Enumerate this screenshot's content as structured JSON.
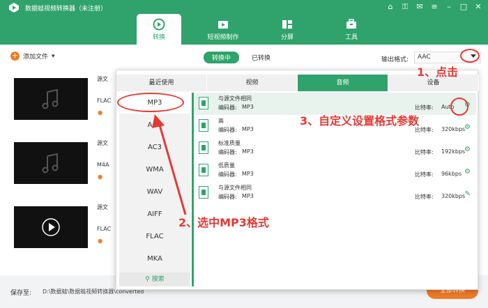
{
  "app": {
    "title": "数据蛙视频转换器（未注册）"
  },
  "main_tabs": [
    {
      "label": "转换",
      "icon": "convert-icon",
      "active": true
    },
    {
      "label": "短视频制作",
      "icon": "video-icon",
      "active": false
    },
    {
      "label": "分屏",
      "icon": "split-screen-icon",
      "active": false
    },
    {
      "label": "工具",
      "icon": "toolbox-icon",
      "active": false
    }
  ],
  "toolbar": {
    "add_file": "添加文件",
    "seg_converting": "转换中",
    "seg_converted": "已转换",
    "output_format_label": "输出格式:",
    "output_format_value": "AAC"
  },
  "files": [
    {
      "source": "源文",
      "format": "FLAC"
    },
    {
      "source": "源文",
      "format": "M4A"
    },
    {
      "source": "源文",
      "format": "FLAC"
    }
  ],
  "bottom": {
    "save_label": "保存至:",
    "save_path": "D:\\数据蛙\\数据蛙视频转换器\\converted",
    "convert_all": "全部转换"
  },
  "format_tabs": [
    {
      "label": "最近使用",
      "active": false
    },
    {
      "label": "视频",
      "active": false
    },
    {
      "label": "音频",
      "active": true
    },
    {
      "label": "设备",
      "active": false
    }
  ],
  "formats": [
    "MP3",
    "AAC",
    "AC3",
    "WMA",
    "WAV",
    "AIFF",
    "FLAC",
    "MKA"
  ],
  "selected_format": "MP3",
  "search_label": "搜索",
  "encoder_label": "编码器:",
  "bitrate_label": "比特率:",
  "qualities": [
    {
      "name": "与源文件相同",
      "encoder": "MP3",
      "bitrate": "Auto"
    },
    {
      "name": "高",
      "encoder": "MP3",
      "bitrate": "320kbps"
    },
    {
      "name": "标准质量",
      "encoder": "MP3",
      "bitrate": "192kbps"
    },
    {
      "name": "低质量",
      "encoder": "MP3",
      "bitrate": "96kbps"
    },
    {
      "name": "与源文件相同",
      "encoder": "MP3",
      "bitrate": "320kbps"
    }
  ],
  "annotations": {
    "step1": "1、点击",
    "step2": "2、选中MP3格式",
    "step3": "3、自定义设置格式参数"
  },
  "colors": {
    "brand": "#2fa36b",
    "accent": "#f07a27",
    "annotation": "#e53935"
  }
}
